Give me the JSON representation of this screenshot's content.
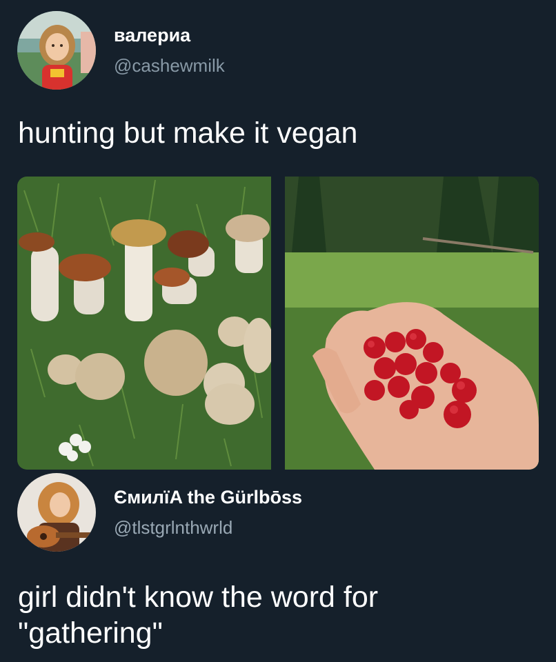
{
  "tweet": {
    "author": {
      "display_name": "валериа",
      "handle": "@cashewmilk",
      "avatar_icon": "avatar-girl-photo"
    },
    "text": "hunting but make it vegan",
    "media": [
      {
        "icon": "mushrooms-on-grass-photo"
      },
      {
        "icon": "hand-holding-raspberries-photo"
      }
    ]
  },
  "reply": {
    "author": {
      "display_name": "ЄмилїA the Gürlbōss",
      "handle": "@tlstgrlnthwrld",
      "avatar_icon": "avatar-guitar-photo"
    },
    "text_line1": "girl didn't know the word for",
    "text_line2": "\"gathering\""
  },
  "colors": {
    "background": "#15202b",
    "primary_text": "#ffffff",
    "secondary_text": "#8899a6"
  }
}
